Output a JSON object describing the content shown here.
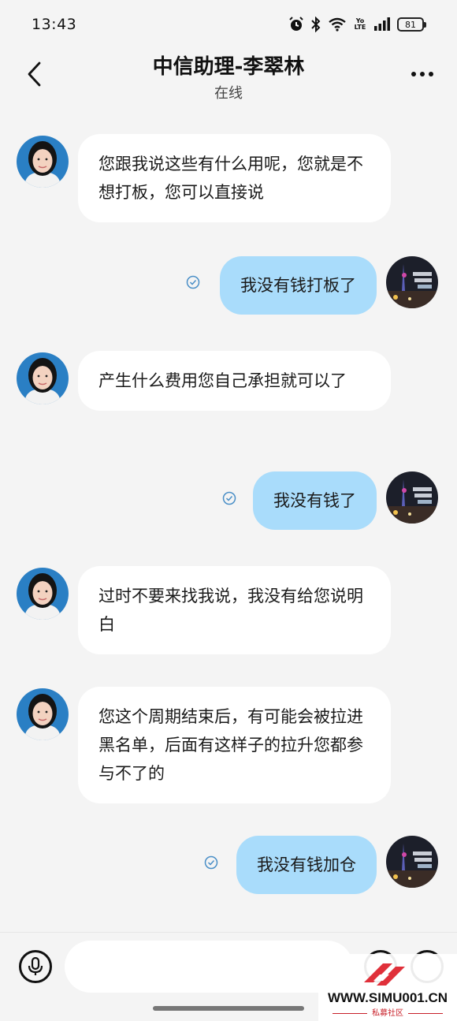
{
  "status_bar": {
    "time": "13:43",
    "network_top": "Yo",
    "network_bottom": "LTE",
    "battery": "81"
  },
  "header": {
    "title": "中信助理-李翠林",
    "status": "在线"
  },
  "messages": [
    {
      "side": "in",
      "text": "您跟我说这些有什么用呢，您就是不想打板，您可以直接说"
    },
    {
      "side": "out",
      "text": "我没有钱打板了"
    },
    {
      "side": "in",
      "text": "产生什么费用您自己承担就可以了"
    },
    {
      "side": "out",
      "text": "我没有钱了"
    },
    {
      "side": "in",
      "text": "过时不要来找我说，我没有给您说明白"
    },
    {
      "side": "in",
      "text": "您这个周期结束后，有可能会被拉进黑名单，后面有这样子的拉升您都参与不了的"
    },
    {
      "side": "out",
      "text": "我没有钱加仓"
    }
  ],
  "input": {
    "value": "",
    "placeholder": ""
  },
  "watermark": {
    "site": "WWW.SIMU001.CN",
    "sub": "私募社区"
  },
  "colors": {
    "outgoing_bubble": "#a9dcfb",
    "incoming_bubble": "#ffffff",
    "background": "#f4f4f4",
    "check": "#4a8fc7"
  },
  "icons": [
    "back-arrow-icon",
    "more-icon",
    "voice-icon",
    "emoji-icon",
    "plus-icon",
    "read-check-icon",
    "alarm-icon",
    "bluetooth-icon",
    "wifi-icon",
    "signal-icon"
  ]
}
